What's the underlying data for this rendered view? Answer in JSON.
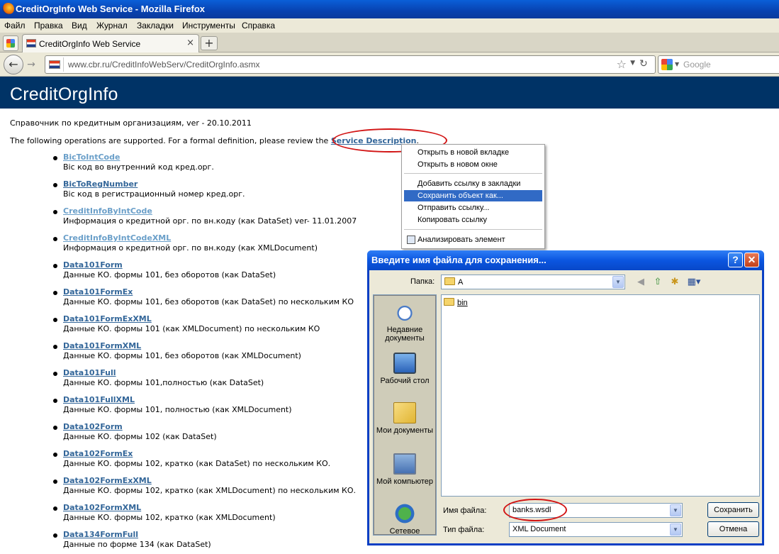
{
  "window": {
    "title": "CreditOrgInfo Web Service - Mozilla Firefox"
  },
  "menu": [
    "Файл",
    "Правка",
    "Вид",
    "Журнал",
    "Закладки",
    "Инструменты",
    "Справка"
  ],
  "tab": {
    "title": "CreditOrgInfo Web Service",
    "close": "×",
    "new_tab": "+"
  },
  "nav": {
    "url": "www.cbr.ru/CreditInfoWebServ/CreditOrgInfo.asmx",
    "search_placeholder": "Google"
  },
  "page": {
    "heading": "CreditOrgInfo",
    "intro": "Справочник по кредитным организациям, ver - 20.10.2011",
    "formal_prefix": "The following operations are supported. For a formal definition, please review the ",
    "service_link": "Service Description",
    "formal_suffix": ".",
    "operations": [
      {
        "name": "BicToIntCode",
        "desc": "Bic код во внутренний код кред.орг.",
        "visited": true
      },
      {
        "name": "BicToRegNumber",
        "desc": "Bic код в регистрационный номер кред.орг.",
        "visited": false
      },
      {
        "name": "CreditInfoByIntCode",
        "desc": "Информация о кредитной орг. по вн.коду (как DataSet) ver- 11.01.2007",
        "visited": true
      },
      {
        "name": "CreditInfoByIntCodeXML",
        "desc": "Информация о кредитной орг. по вн.коду (как XMLDocument)",
        "visited": true
      },
      {
        "name": "Data101Form",
        "desc": "Данные КО. формы 101, без оборотов (как DataSet)",
        "visited": false
      },
      {
        "name": "Data101FormEx",
        "desc": "Данные КО. формы 101, без оборотов (как DataSet) по нескольким КО",
        "visited": false
      },
      {
        "name": "Data101FormExXML",
        "desc": "Данные КО. формы 101 (как XMLDocument) по нескольким КО",
        "visited": false
      },
      {
        "name": "Data101FormXML",
        "desc": "Данные КО. формы 101, без оборотов (как XMLDocument)",
        "visited": false
      },
      {
        "name": "Data101Full",
        "desc": "Данные КО. формы 101,полностью (как DataSet)",
        "visited": false
      },
      {
        "name": "Data101FullXML",
        "desc": "Данные КО. формы 101, полностью (как XMLDocument)",
        "visited": false
      },
      {
        "name": "Data102Form",
        "desc": "Данные КО. формы 102 (как DataSet)",
        "visited": false
      },
      {
        "name": "Data102FormEx",
        "desc": "Данные КО. формы 102, кратко (как DataSet) по нескольким КО.",
        "visited": false
      },
      {
        "name": "Data102FormExXML",
        "desc": "Данные КО. формы 102, кратко (как XMLDocument) по нескольким КО.",
        "visited": false
      },
      {
        "name": "Data102FormXML",
        "desc": "Данные КО. формы 102, кратко (как XMLDocument)",
        "visited": false
      },
      {
        "name": "Data134FormFull",
        "desc": "Данные по форме 134 (как DataSet)",
        "visited": false
      }
    ]
  },
  "context_menu": {
    "items": [
      "Открыть в новой вкладке",
      "Открыть в новом окне",
      "Добавить ссылку в закладки",
      "Сохранить объект как...",
      "Отправить ссылку...",
      "Копировать ссылку",
      "Анализировать элемент"
    ],
    "selected_index": 3
  },
  "dialog": {
    "title": "Введите имя файла для сохранения...",
    "help": "?",
    "close": "✕",
    "folder_label": "Папка:",
    "folder_value": "A",
    "places": [
      "Недавние документы",
      "Рабочий стол",
      "Мои документы",
      "Мой компьютер",
      "Сетевое"
    ],
    "files": [
      "bin"
    ],
    "filename_label": "Имя файла:",
    "filename_value": "banks.wsdl",
    "filetype_label": "Тип файла:",
    "filetype_value": "XML Document",
    "save_button": "Сохранить",
    "cancel_button": "Отмена"
  },
  "colors": {
    "header_bg": "#003366",
    "link": "#336699",
    "annotation": "#d21414",
    "menu_highlight": "#316ac5"
  }
}
